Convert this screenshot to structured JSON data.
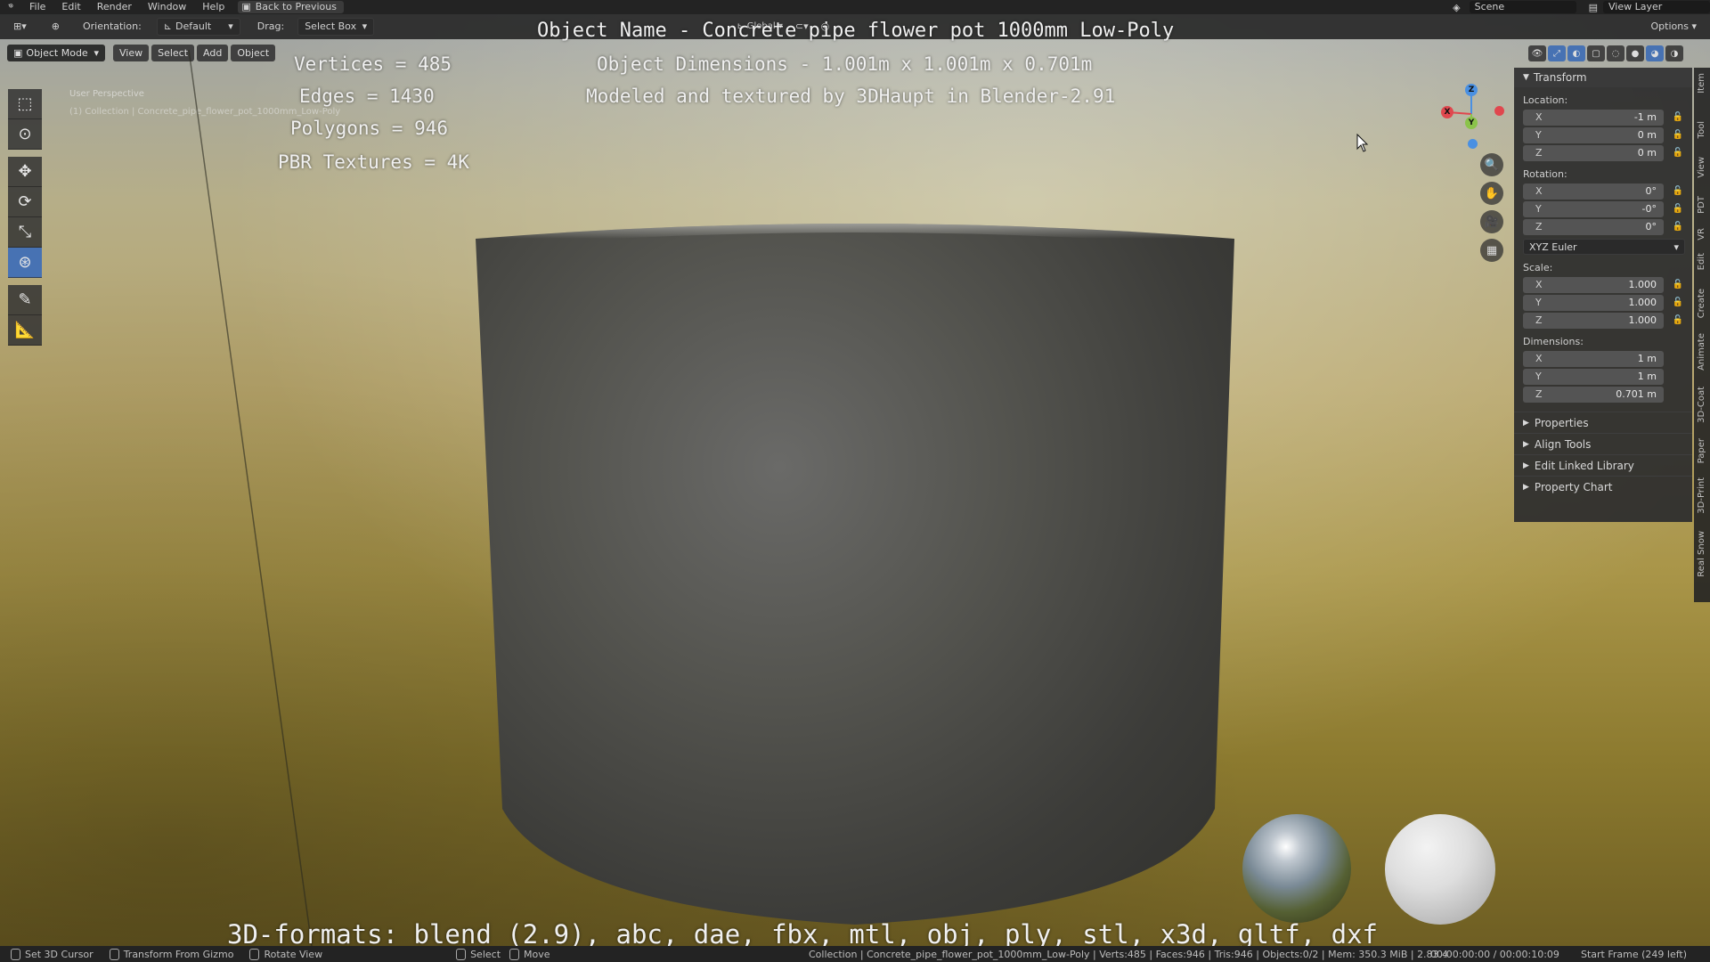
{
  "menubar": {
    "items": [
      "File",
      "Edit",
      "Render",
      "Window",
      "Help"
    ],
    "back_button": "Back to Previous",
    "scene": "Scene",
    "view_layer": "View Layer"
  },
  "viewport_header": {
    "orientation_label": "Orientation:",
    "orientation_value": "Default",
    "drag_label": "Drag:",
    "drag_value": "Select Box",
    "transform_space": "Global",
    "options": "Options"
  },
  "viewport_menu": {
    "mode": "Object Mode",
    "items": [
      "View",
      "Select",
      "Add",
      "Object"
    ]
  },
  "overlay": {
    "user_perspective": "User Perspective",
    "collection_line": "(1) Collection | Concrete_pipe_flower_pot_1000mm_Low-Poly",
    "title": "Object Name - Concrete pipe flower pot 1000mm Low-Poly",
    "vertices": "Vertices = 485",
    "edges": "Edges = 1430",
    "polygons": "Polygons = 946",
    "textures": "PBR Textures = 4K",
    "dimensions": "Object Dimensions -  1.001m x 1.001m x 0.701m",
    "credit": "Modeled and textured by 3DHaupt in Blender-2.91",
    "formats": "3D-formats: blend (2.9), abc, dae, fbx, mtl, obj, ply, stl, x3d, gltf, dxf"
  },
  "gizmo": {
    "x": "X",
    "y": "Y",
    "z": "Z"
  },
  "npanel": {
    "transform_title": "Transform",
    "location_label": "Location:",
    "location": [
      {
        "axis": "X",
        "value": "-1 m"
      },
      {
        "axis": "Y",
        "value": "0 m"
      },
      {
        "axis": "Z",
        "value": "0 m"
      }
    ],
    "rotation_label": "Rotation:",
    "rotation": [
      {
        "axis": "X",
        "value": "0°"
      },
      {
        "axis": "Y",
        "value": "-0°"
      },
      {
        "axis": "Z",
        "value": "0°"
      }
    ],
    "rotation_mode": "XYZ Euler",
    "scale_label": "Scale:",
    "scale": [
      {
        "axis": "X",
        "value": "1.000"
      },
      {
        "axis": "Y",
        "value": "1.000"
      },
      {
        "axis": "Z",
        "value": "1.000"
      }
    ],
    "dimensions_label": "Dimensions:",
    "dimensions": [
      {
        "axis": "X",
        "value": "1 m"
      },
      {
        "axis": "Y",
        "value": "1 m"
      },
      {
        "axis": "Z",
        "value": "0.701 m"
      }
    ],
    "sections": [
      "Properties",
      "Align Tools",
      "Edit Linked Library",
      "Property Chart"
    ]
  },
  "vtabs": [
    "Item",
    "Tool",
    "View",
    "PDT",
    "VR",
    "Edit",
    "Create",
    "Animate",
    "3D-Coat",
    "Paper",
    "3D-Print",
    "Real Snow"
  ],
  "statusbar": {
    "cursor": "Set 3D Cursor",
    "gizmo": "Transform From Gizmo",
    "rotate": "Rotate View",
    "select": "Select",
    "move": "Move",
    "info": "Collection | Concrete_pipe_flower_pot_1000mm_Low-Poly | Verts:485 | Faces:946 | Tris:946 | Objects:0/2 | Mem: 350.3 MiB | 2.83.4",
    "time": "00:00:00:00 / 00:00:10:09",
    "start": "Start Frame (249 left)"
  },
  "colors": {
    "accent": "#4772b3",
    "panel": "#2e2e2e",
    "axis_x": "#e0474e",
    "axis_y": "#8bc34a",
    "axis_z": "#4a90e2"
  }
}
